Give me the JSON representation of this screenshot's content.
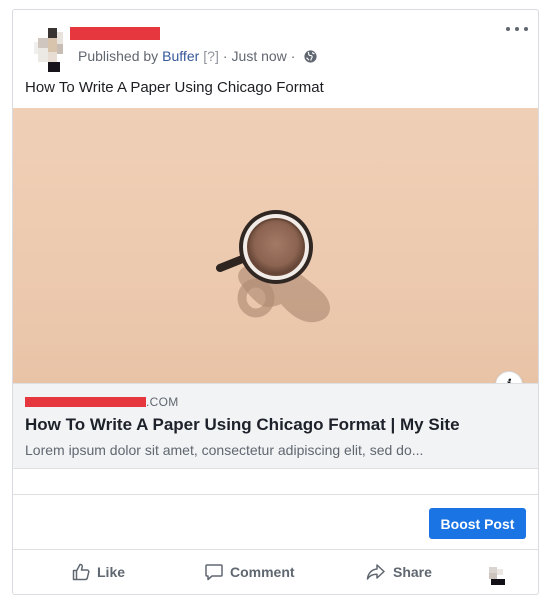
{
  "post": {
    "published_prefix": "Published by",
    "publisher": "Buffer",
    "help_marker": "[?]",
    "separator": "·",
    "time": "Just now",
    "text": "How To Write A Paper Using Chicago Format"
  },
  "link_preview": {
    "domain_suffix": ".COM",
    "title": "How To Write A Paper Using Chicago Format | My Site",
    "description": "Lorem ipsum dolor sit amet, consectetur adipiscing elit, sed do..."
  },
  "buttons": {
    "boost": "Boost Post"
  },
  "actions": {
    "like": "Like",
    "comment": "Comment",
    "share": "Share"
  },
  "icons": {
    "more": "more-horizontal-icon",
    "privacy": "globe-icon",
    "info": "info-icon",
    "like": "thumbs-up-icon",
    "comment": "comment-bubble-icon",
    "share": "share-arrow-icon"
  },
  "colors": {
    "accent": "#1b74e4",
    "link": "#365899",
    "redaction": "#e6373f",
    "image_background": "#eccab0"
  }
}
